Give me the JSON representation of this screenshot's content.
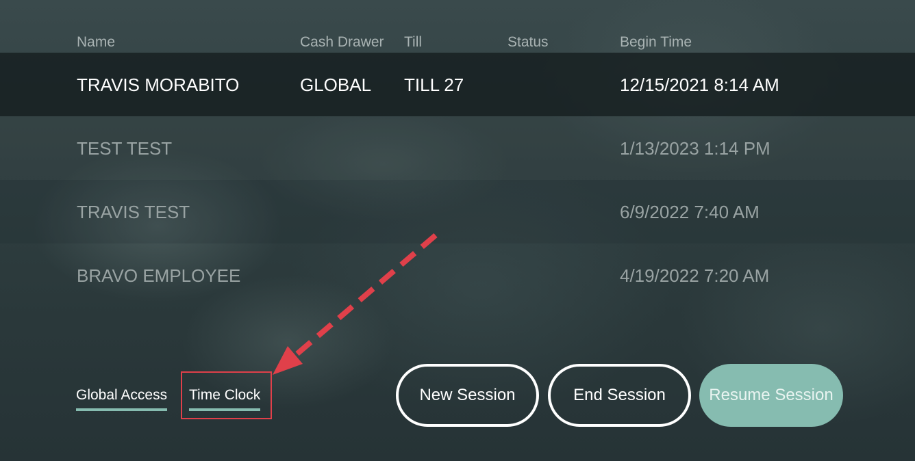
{
  "columns": {
    "name": "Name",
    "cash_drawer": "Cash Drawer",
    "till": "Till",
    "status": "Status",
    "begin_time": "Begin Time"
  },
  "sessions": [
    {
      "name": "TRAVIS MORABITO",
      "cash_drawer": "GLOBAL",
      "till": "TILL 27",
      "status": "",
      "begin_time": "12/15/2021 8:14 AM",
      "selected": true
    },
    {
      "name": "TEST TEST",
      "cash_drawer": "",
      "till": "",
      "status": "",
      "begin_time": "1/13/2023 1:14 PM",
      "selected": false
    },
    {
      "name": "TRAVIS TEST",
      "cash_drawer": "",
      "till": "",
      "status": "",
      "begin_time": "6/9/2022 7:40 AM",
      "selected": false
    },
    {
      "name": "BRAVO EMPLOYEE",
      "cash_drawer": "",
      "till": "",
      "status": "",
      "begin_time": "4/19/2022 7:20 AM",
      "selected": false
    }
  ],
  "footer": {
    "global_access_label": "Global Access",
    "time_clock_label": "Time Clock",
    "new_session_label": "New Session",
    "end_session_label": "End Session",
    "resume_session_label": "Resume Session"
  },
  "colors": {
    "accent": "#86bcb0",
    "annotation": "#e0404a",
    "selected_row_bg": "#161e20"
  },
  "icons": {
    "annotation_arrow": "dashed-arrow-icon"
  }
}
